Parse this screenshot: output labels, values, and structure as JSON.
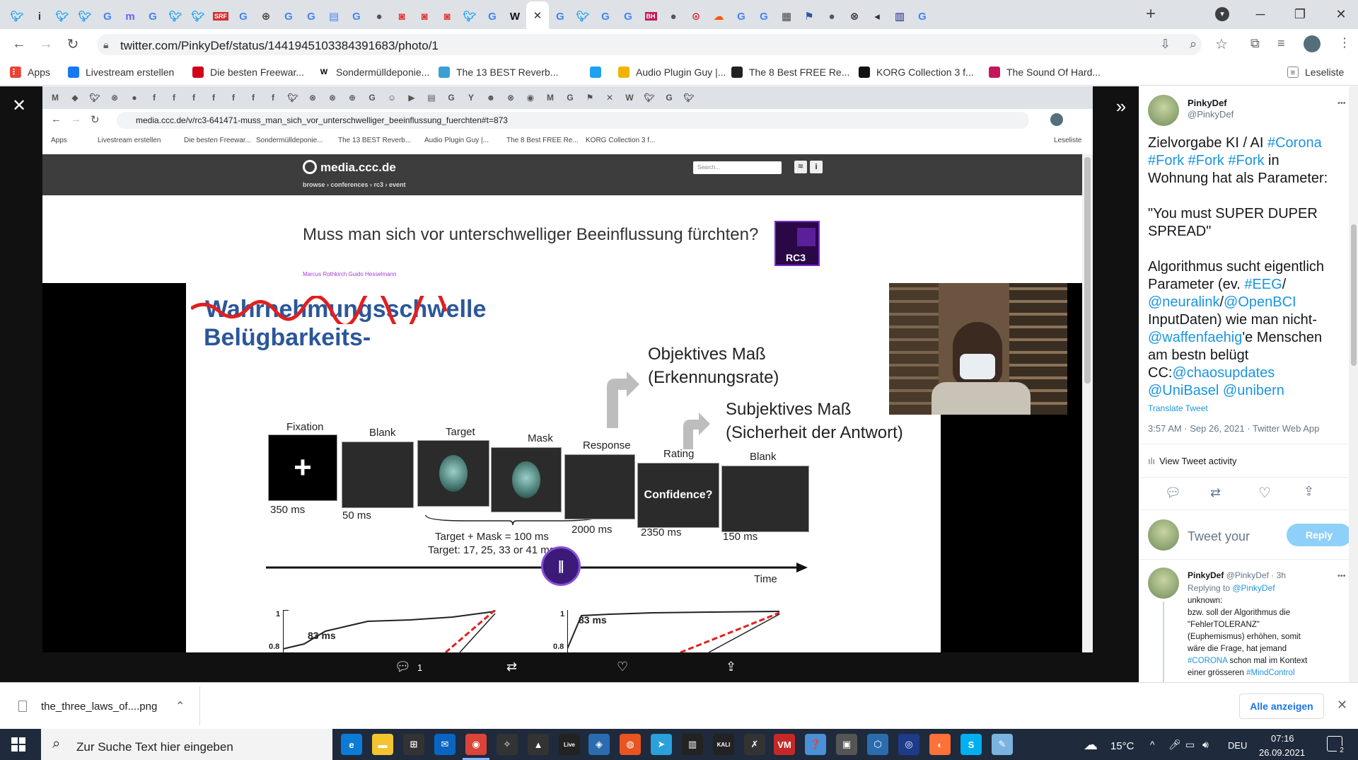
{
  "window": {
    "tabs": [
      "twitter",
      "info",
      "twitter",
      "twitter",
      "google",
      "mastodon",
      "google",
      "twitter",
      "twitter",
      "srf",
      "google",
      "globe",
      "google",
      "google",
      "docs",
      "google",
      "circle",
      "red",
      "red",
      "red",
      "twitter",
      "google",
      "wikipedia",
      "close",
      "google",
      "twitter",
      "google",
      "google",
      "bh",
      "circle",
      "car",
      "soundcloud",
      "google",
      "google",
      "pattern",
      "flag",
      "circle",
      "close-circle",
      "mute",
      "chart",
      "google"
    ],
    "new_tab": "+",
    "minimize": "─",
    "maximize": "❐",
    "close": "✕"
  },
  "addressbar": {
    "url": "twitter.com/PinkyDef/status/1441945103384391683/photo/1"
  },
  "bookmarks": [
    {
      "label": "Apps",
      "icon": "apps-icon",
      "color": "#ea4335"
    },
    {
      "label": "Livestream erstellen",
      "icon": "facebook-icon",
      "color": "#1877f2"
    },
    {
      "label": "Die besten Freewar...",
      "icon": "star-icon",
      "color": "#d0021b"
    },
    {
      "label": "Sondermülldeponie...",
      "icon": "wikipedia-icon",
      "color": "#000000"
    },
    {
      "label": "The 13 BEST Reverb...",
      "icon": "m-icon",
      "color": "#3aa0d0"
    },
    {
      "label": "",
      "icon": "twitter-icon",
      "color": "#1da1f2"
    },
    {
      "label": "Audio Plugin Guy |...",
      "icon": "apg-icon",
      "color": "#f0b400"
    },
    {
      "label": "The 8 Best FREE Re...",
      "icon": "moon-icon",
      "color": "#222222"
    },
    {
      "label": "KORG Collection 3 f...",
      "icon": "korg-icon",
      "color": "#111111"
    },
    {
      "label": "The Sound Of Hard...",
      "icon": "soundofhard-icon",
      "color": "#c2185b"
    }
  ],
  "reading_list": "Leseliste",
  "inner": {
    "url": "media.ccc.de/v/rc3-641471-muss_man_sich_vor_unterschwelliger_beeinflussung_fuerchten#t=873",
    "bookmarks": [
      "Apps",
      "Livestream erstellen",
      "Die besten Freewar...",
      "Sondermülldeponie...",
      "The 13 BEST Reverb...",
      "Audio Plugin Guy |...",
      "The 8 Best FREE Re...",
      "KORG Collection 3 f..."
    ],
    "reading_list": "Leseliste",
    "site_logo": "media.ccc.de",
    "breadcrumb": "browse › conferences › rc3 › event",
    "search_placeholder": "Search...",
    "talk_title": "Muss man sich vor unterschwelliger Beeinflussung fürchten?",
    "authors": "Marcus Rothkirch Guido Hesselmann",
    "rc3_label": "RC3",
    "slide": {
      "struck": "Wahrnehmungsschwelle",
      "heading2": "Belügbarkeits-",
      "objektiv1": "Objektives Maß",
      "objektiv2": "(Erkennungsrate)",
      "subjektiv1": "Subjektives Maß",
      "subjektiv2": "(Sicherheit der Antwort)",
      "steps": [
        {
          "label": "Fixation",
          "time": "350 ms"
        },
        {
          "label": "Blank",
          "time": "50 ms"
        },
        {
          "label": "Target",
          "time": ""
        },
        {
          "label": "Mask",
          "time": ""
        },
        {
          "label": "Response",
          "time": "2000 ms"
        },
        {
          "label": "Rating",
          "time": "2350 ms"
        },
        {
          "label": "Blank",
          "time": "150 ms"
        }
      ],
      "confidence": "Confidence?",
      "fixation_cross": "+",
      "target_mask": "Target + Mask = 100 ms",
      "target_times": "Target: 17, 25, 33 or 41 ms",
      "time_axis": "Time",
      "plot1_label": "83 ms",
      "plot2_label": "83 ms",
      "tick_1": "1",
      "tick_08": "0.8"
    }
  },
  "tweet_actions": {
    "replies": "1"
  },
  "panel": {
    "name": "PinkyDef",
    "handle": "@PinkyDef",
    "more": "•••",
    "tweet_lines": [
      {
        "parts": [
          {
            "t": "Zielvorgabe KI / AI ",
            "link": false
          },
          {
            "t": "#Corona",
            "link": true
          }
        ]
      },
      {
        "parts": [
          {
            "t": "#Fork #Fork #Fork",
            "link": true
          },
          {
            "t": " in",
            "link": false
          }
        ]
      },
      {
        "parts": [
          {
            "t": "Wohnung hat als Parameter:",
            "link": false
          }
        ]
      },
      {
        "parts": [
          {
            "t": "",
            "link": false
          }
        ]
      },
      {
        "parts": [
          {
            "t": "\"You must SUPER DUPER",
            "link": false
          }
        ]
      },
      {
        "parts": [
          {
            "t": "SPREAD\"",
            "link": false
          }
        ]
      },
      {
        "parts": [
          {
            "t": "",
            "link": false
          }
        ]
      },
      {
        "parts": [
          {
            "t": "Algorithmus sucht eigentlich",
            "link": false
          }
        ]
      },
      {
        "parts": [
          {
            "t": "Parameter (ev. ",
            "link": false
          },
          {
            "t": "#EEG",
            "link": true
          },
          {
            "t": "/",
            "link": false
          }
        ]
      },
      {
        "parts": [
          {
            "t": "@neuralink",
            "link": true
          },
          {
            "t": "/",
            "link": false
          },
          {
            "t": "@OpenBCI",
            "link": true
          }
        ]
      },
      {
        "parts": [
          {
            "t": "InputDaten) wie man nicht-",
            "link": false
          }
        ]
      },
      {
        "parts": [
          {
            "t": "@waffenfaehig",
            "link": true
          },
          {
            "t": "'e Menschen",
            "link": false
          }
        ]
      },
      {
        "parts": [
          {
            "t": "am bestn belügt",
            "link": false
          }
        ]
      },
      {
        "parts": [
          {
            "t": "CC:",
            "link": false
          },
          {
            "t": "@chaosupdates",
            "link": true
          }
        ]
      },
      {
        "parts": [
          {
            "t": "@UniBasel @unibern",
            "link": true
          }
        ]
      }
    ],
    "translate": "Translate Tweet",
    "meta": "3:57 AM · Sep 26, 2021 · Twitter Web App",
    "activity": "View Tweet activity",
    "reply_placeholder": "Tweet your",
    "reply_button": "Reply",
    "reply": {
      "name": "PinkyDef",
      "handle_time": "@PinkyDef · 3h",
      "replying_prefix": "Replying to ",
      "replying_to": "@PinkyDef",
      "lines": [
        {
          "parts": [
            {
              "t": "unknown:",
              "link": false
            }
          ]
        },
        {
          "parts": [
            {
              "t": "bzw. soll der Algorithmus die",
              "link": false
            }
          ]
        },
        {
          "parts": [
            {
              "t": "\"FehlerTOLERANZ\"",
              "link": false
            }
          ]
        },
        {
          "parts": [
            {
              "t": "(Euphemismus) erhöhen, somit",
              "link": false
            }
          ]
        },
        {
          "parts": [
            {
              "t": "wäre die Frage, hat jemand",
              "link": false
            }
          ]
        },
        {
          "parts": [
            {
              "t": "#CORONA",
              "link": true
            },
            {
              "t": " schon mal im Kontext",
              "link": false
            }
          ]
        },
        {
          "parts": [
            {
              "t": "einer grösseren ",
              "link": false
            },
            {
              "t": "#MindControl",
              "link": true
            }
          ]
        }
      ]
    }
  },
  "download": {
    "filename": "the_three_laws_of....png",
    "show_all": "Alle anzeigen"
  },
  "taskbar": {
    "search_placeholder": "Zur Suche Text hier eingeben",
    "weather": "15°C",
    "lang": "DEU",
    "time": "07:16",
    "date": "26.09.2021",
    "notifications": "2"
  },
  "colors": {
    "twitter_blue": "#1da1f2",
    "link": "#1b95e0"
  }
}
